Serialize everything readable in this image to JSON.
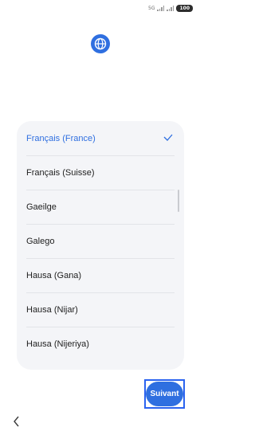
{
  "status_bar": {
    "network": "5G",
    "battery": "100"
  },
  "header": {
    "icon": "globe-icon"
  },
  "language_list": {
    "items": [
      {
        "label": "Français (France)",
        "selected": true
      },
      {
        "label": "Français (Suisse)",
        "selected": false
      },
      {
        "label": "Gaeilge",
        "selected": false
      },
      {
        "label": "Galego",
        "selected": false
      },
      {
        "label": "Hausa (Gana)",
        "selected": false
      },
      {
        "label": "Hausa (Nijar)",
        "selected": false
      },
      {
        "label": "Hausa (Nijeriya)",
        "selected": false
      }
    ]
  },
  "footer": {
    "next_label": "Suivant",
    "back_icon": "chevron-left-icon"
  },
  "colors": {
    "accent": "#2f6fe0",
    "card_background": "#f4f5f8",
    "highlight_border": "#2b63f0"
  }
}
